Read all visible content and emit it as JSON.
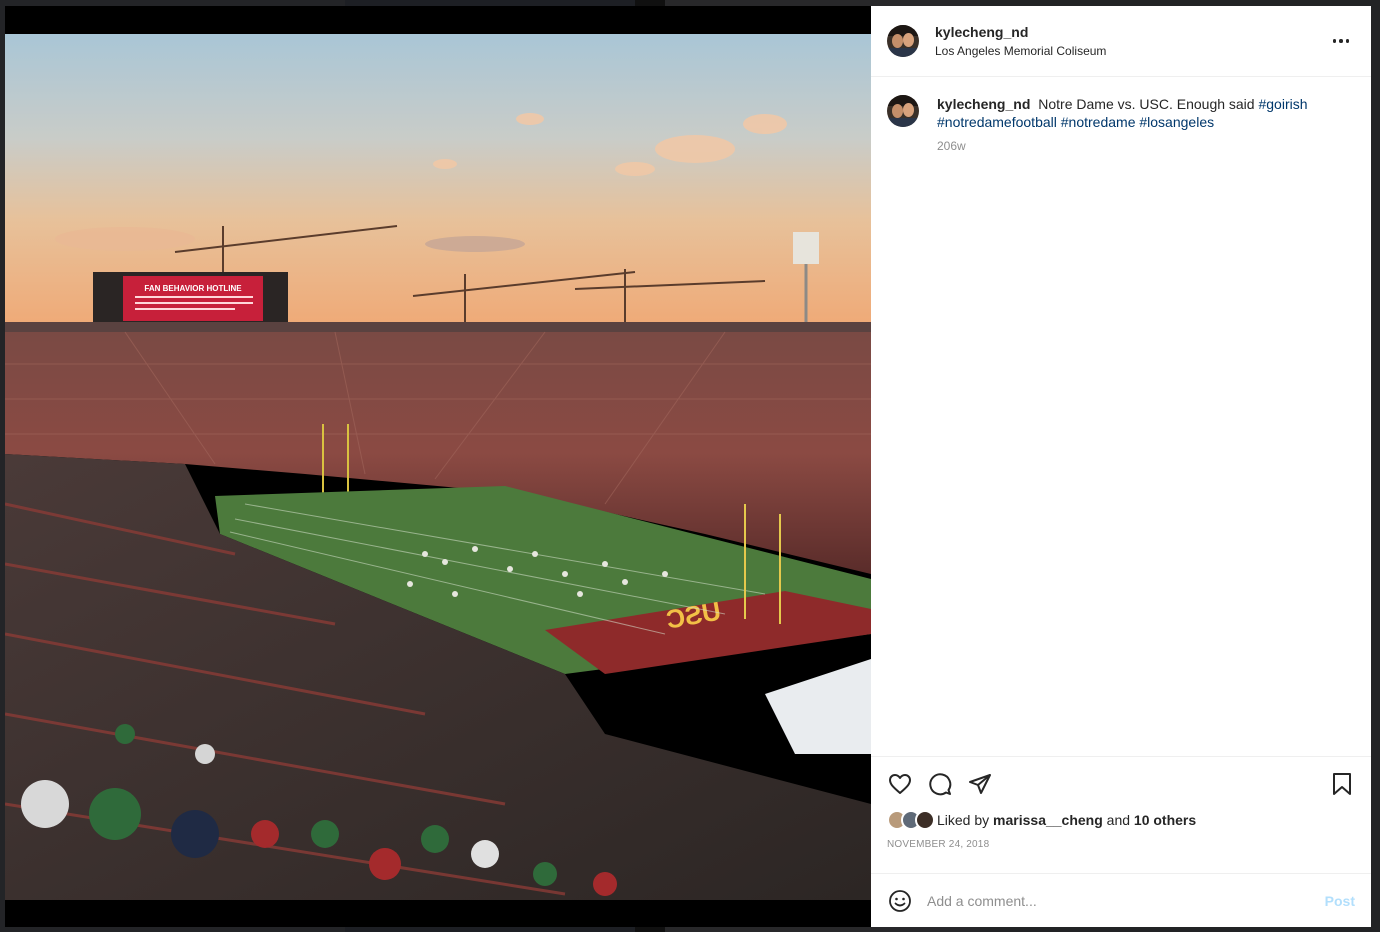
{
  "post": {
    "username": "kylecheng_nd",
    "location": "Los Angeles Memorial Coliseum",
    "caption": {
      "text": "Notre Dame vs. USC. Enough said",
      "hashtags": [
        "#goirish",
        "#notredamefootball",
        "#notredame",
        "#losangeles"
      ]
    },
    "time_ago": "206w",
    "photo": {
      "scoreboard_title": "FAN BEHAVIOR HOTLINE",
      "end_zone_text": "USC"
    }
  },
  "icons": {
    "more": "more-horizontal-icon",
    "like": "heart-icon",
    "comment": "comment-bubble-icon",
    "share": "paper-plane-icon",
    "save": "bookmark-icon",
    "emoji": "emoji-smile-icon"
  },
  "likes": {
    "prefix": "Liked by",
    "user": "marissa__cheng",
    "connector": "and",
    "others": "10 others"
  },
  "date": "NOVEMBER 24, 2018",
  "comment": {
    "placeholder": "Add a comment...",
    "post_label": "Post"
  },
  "colors": {
    "hashtag": "#00376b",
    "post_button_disabled": "#b2dffc",
    "secondary_text": "#8e8e8e"
  }
}
